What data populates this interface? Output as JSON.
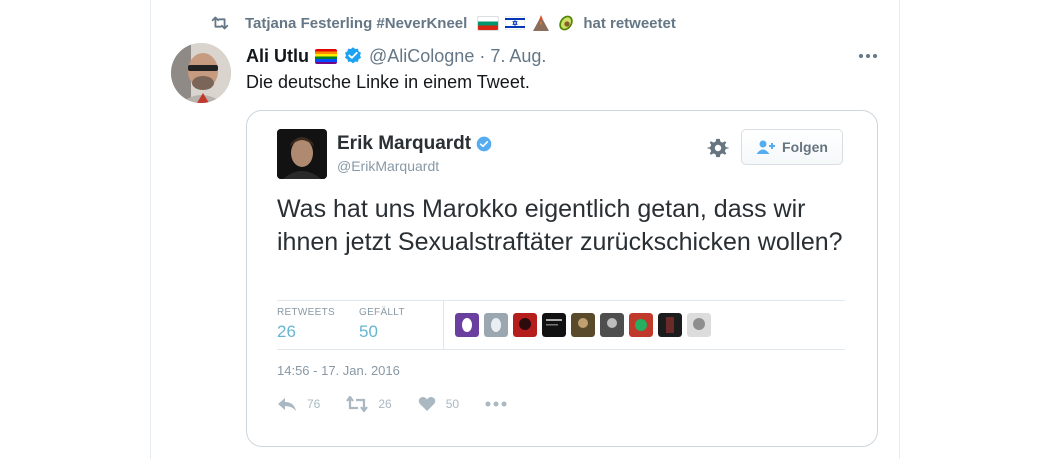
{
  "retweet_line": {
    "user": "Tatjana Festerling #NeverKneel",
    "suffix": "hat retweetet",
    "emojis": [
      "bulgaria-flag",
      "israel-flag",
      "volcano-emoji",
      "avocado-emoji"
    ]
  },
  "tweet": {
    "author": "Ali Utlu",
    "handle_date": "@AliCologne · 7. Aug.",
    "text": "Die deutsche Linke in einem Tweet."
  },
  "embedded": {
    "name": "Erik Marquardt",
    "handle": "@ErikMarquardt",
    "follow_label": "Folgen",
    "text": "Was hat uns Marokko eigentlich getan, dass wir ihnen jetzt Sexualstraftäter zurückschicken wollen?",
    "retweets_label": "RETWEETS",
    "retweets": "26",
    "likes_label": "GEFÄLLT",
    "likes": "50",
    "timestamp": "14:56 - 17. Jan. 2016",
    "reply_count": "76",
    "retweet_count": "26",
    "like_count": "50"
  },
  "colors": {
    "verified": "#1da1f2",
    "stat_value": "#66b5d2",
    "muted": "#657786"
  }
}
